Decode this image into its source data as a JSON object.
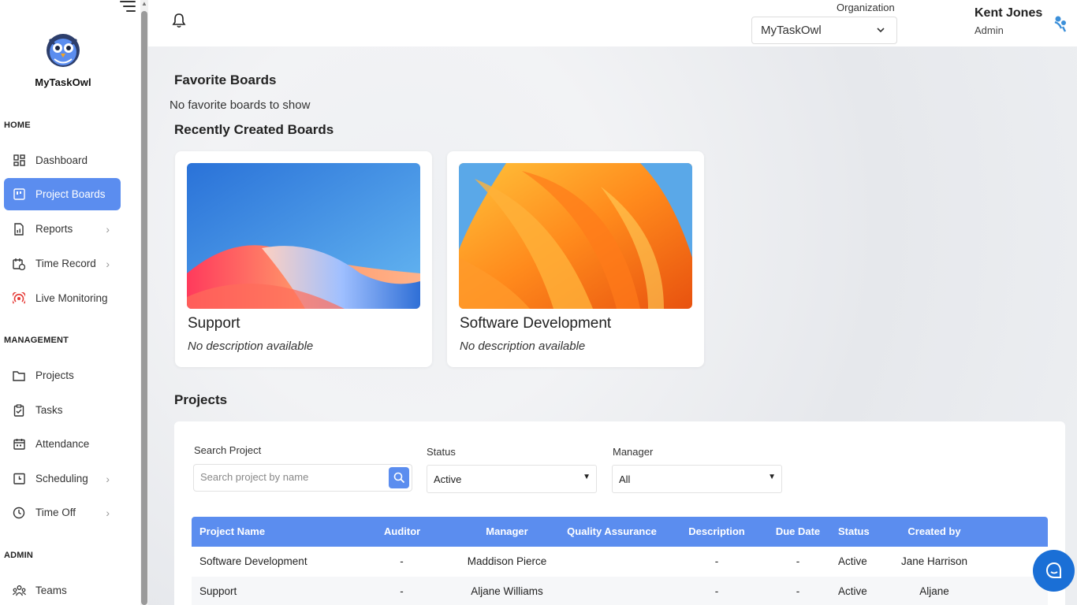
{
  "app": {
    "name": "MyTaskOwl"
  },
  "sidebar": {
    "sections": {
      "home": "HOME",
      "management": "MANAGEMENT",
      "admin": "ADMIN"
    },
    "items": [
      {
        "label": "Dashboard",
        "icon": "dashboard-icon"
      },
      {
        "label": "Project Boards",
        "icon": "board-icon",
        "active": true
      },
      {
        "label": "Reports",
        "icon": "report-icon",
        "expandable": true
      },
      {
        "label": "Time Record",
        "icon": "time-record-icon",
        "expandable": true
      },
      {
        "label": "Live Monitoring",
        "icon": "live-monitoring-icon"
      },
      {
        "label": "Projects",
        "icon": "folder-icon"
      },
      {
        "label": "Tasks",
        "icon": "clipboard-icon"
      },
      {
        "label": "Attendance",
        "icon": "calendar-icon"
      },
      {
        "label": "Scheduling",
        "icon": "schedule-icon",
        "expandable": true
      },
      {
        "label": "Time Off",
        "icon": "clock-icon",
        "expandable": true
      },
      {
        "label": "Teams",
        "icon": "teams-icon"
      }
    ]
  },
  "topbar": {
    "organization_label": "Organization",
    "organization_value": "MyTaskOwl",
    "user_name": "Kent Jones",
    "user_role": "Admin"
  },
  "main": {
    "favorite_title": "Favorite Boards",
    "favorite_empty": "No favorite boards to show",
    "recent_title": "Recently Created Boards",
    "boards": [
      {
        "title": "Support",
        "description": "No description available"
      },
      {
        "title": "Software Development",
        "description": "No description available"
      }
    ],
    "projects_title": "Projects"
  },
  "filters": {
    "search_label": "Search Project",
    "search_placeholder": "Search project by name",
    "status_label": "Status",
    "status_value": "Active",
    "manager_label": "Manager",
    "manager_value": "All"
  },
  "table": {
    "headers": [
      "Project Name",
      "Auditor",
      "Manager",
      "Quality Assurance",
      "Description",
      "Due Date",
      "Status",
      "Created by"
    ],
    "rows": [
      [
        "Software Development",
        "-",
        "Maddison Pierce",
        "",
        "-",
        "-",
        "Active",
        "Jane Harrison"
      ],
      [
        "Support",
        "-",
        "Aljane Williams",
        "",
        "-",
        "-",
        "Active",
        "Aljane"
      ]
    ]
  },
  "colors": {
    "accent": "#5b8def",
    "chat": "#1a6fd6"
  }
}
